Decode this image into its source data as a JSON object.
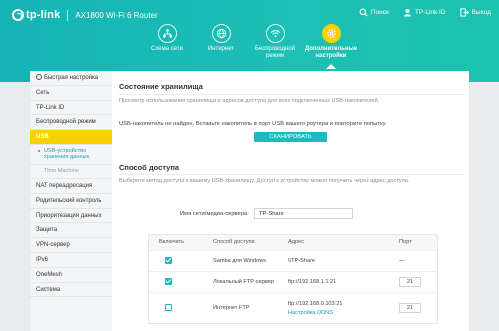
{
  "header": {
    "brand": "tp-link",
    "model": "AX1800 Wi-Fi 6 Router",
    "links": [
      {
        "label": "Поиск",
        "icon": "search-icon"
      },
      {
        "label": "TP-Link ID",
        "icon": "user-icon"
      },
      {
        "label": "Выход",
        "icon": "logout-icon"
      }
    ],
    "nav": [
      {
        "label": "Схема сети",
        "icon": "network-map-icon"
      },
      {
        "label": "Интернет",
        "icon": "globe-icon"
      },
      {
        "label": "Беспроводной режим",
        "icon": "wifi-icon"
      },
      {
        "label": "Дополнительные настройки",
        "icon": "gear-icon",
        "active": true
      }
    ]
  },
  "sidebar": {
    "items": [
      {
        "label": "Быстрая настройка"
      },
      {
        "label": "Сеть"
      },
      {
        "label": "TP-Link ID"
      },
      {
        "label": "Беспроводной режим"
      },
      {
        "label": "USB",
        "active": true
      }
    ],
    "sub_active": "USB-устройство хранения данных",
    "sub_other": "Time Machine",
    "more_items": [
      {
        "label": "NAT переадресация"
      },
      {
        "label": "Родительский контроль"
      },
      {
        "label": "Приоритезация данных"
      },
      {
        "label": "Защита"
      },
      {
        "label": "VPN-сервер"
      },
      {
        "label": "IPv6"
      },
      {
        "label": "OneMesh"
      },
      {
        "label": "Система"
      }
    ]
  },
  "storage": {
    "title": "Состояние хранилища",
    "description": "Просмотр использования хранилища и адресов доступа для всех подключенных USB-накопителей.",
    "notice": "USB-накопитель не найден. Вставьте накопитель в порт USB вашего роутера и повторите попытку.",
    "scan_button": "СКАНИРОВАТЬ"
  },
  "access": {
    "title": "Способ доступа",
    "description": "Выберите метод доступа к вашему USB-хранилищу. Доступ к устройству можно получить через адрес доступа.",
    "server_label": "Имя сети/медиа-сервера:",
    "server_value": "TP-Share",
    "table": {
      "headers": [
        "Включить",
        "Способ доступа",
        "Адрес",
        "Порт"
      ],
      "rows": [
        {
          "enabled": true,
          "method": "Samba для Windows",
          "address": "\\\\TP-Share",
          "port": "—",
          "port_editable": false
        },
        {
          "enabled": true,
          "method": "Локальный FTP-сервер",
          "address": "ftp://192.168.1.1:21",
          "port": "21",
          "port_editable": true
        },
        {
          "enabled": false,
          "method": "Интернет FTP",
          "address": "ftp://192.168.0.103:21",
          "link": "Настройка DDNS",
          "port": "21",
          "port_editable": true
        }
      ]
    }
  }
}
